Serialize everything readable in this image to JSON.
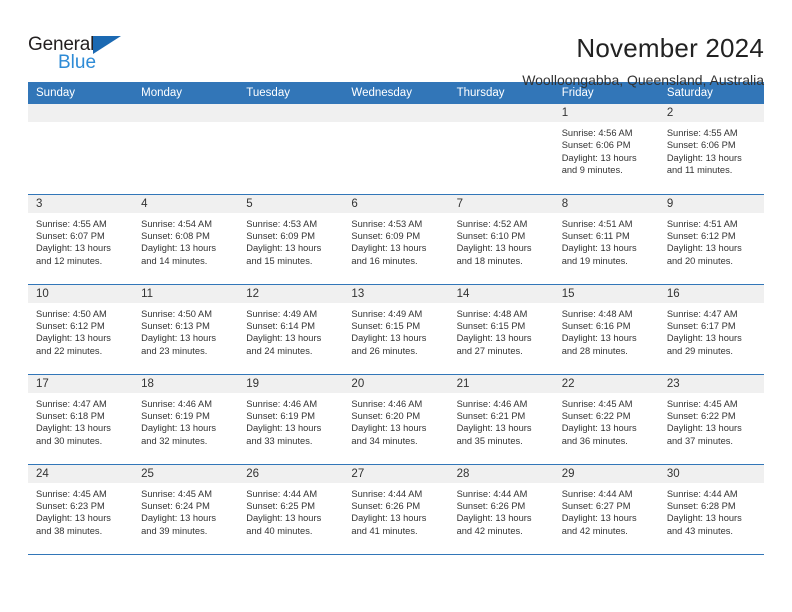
{
  "brand": {
    "name_part1": "General",
    "name_part2": "Blue",
    "triangle_icon": "triangle-icon",
    "accent_color": "#2e8bd6",
    "dark_color": "#231f20"
  },
  "header": {
    "title": "November 2024",
    "subtitle": "Woolloongabba, Queensland, Australia"
  },
  "calendar": {
    "header_bg": "#3276b8",
    "daynum_bg": "#f0f0f0",
    "weekdays": [
      "Sunday",
      "Monday",
      "Tuesday",
      "Wednesday",
      "Thursday",
      "Friday",
      "Saturday"
    ],
    "weeks": [
      [
        {
          "day": "",
          "lines": []
        },
        {
          "day": "",
          "lines": []
        },
        {
          "day": "",
          "lines": []
        },
        {
          "day": "",
          "lines": []
        },
        {
          "day": "",
          "lines": []
        },
        {
          "day": "1",
          "lines": [
            "Sunrise: 4:56 AM",
            "Sunset: 6:06 PM",
            "Daylight: 13 hours",
            "and 9 minutes."
          ]
        },
        {
          "day": "2",
          "lines": [
            "Sunrise: 4:55 AM",
            "Sunset: 6:06 PM",
            "Daylight: 13 hours",
            "and 11 minutes."
          ]
        }
      ],
      [
        {
          "day": "3",
          "lines": [
            "Sunrise: 4:55 AM",
            "Sunset: 6:07 PM",
            "Daylight: 13 hours",
            "and 12 minutes."
          ]
        },
        {
          "day": "4",
          "lines": [
            "Sunrise: 4:54 AM",
            "Sunset: 6:08 PM",
            "Daylight: 13 hours",
            "and 14 minutes."
          ]
        },
        {
          "day": "5",
          "lines": [
            "Sunrise: 4:53 AM",
            "Sunset: 6:09 PM",
            "Daylight: 13 hours",
            "and 15 minutes."
          ]
        },
        {
          "day": "6",
          "lines": [
            "Sunrise: 4:53 AM",
            "Sunset: 6:09 PM",
            "Daylight: 13 hours",
            "and 16 minutes."
          ]
        },
        {
          "day": "7",
          "lines": [
            "Sunrise: 4:52 AM",
            "Sunset: 6:10 PM",
            "Daylight: 13 hours",
            "and 18 minutes."
          ]
        },
        {
          "day": "8",
          "lines": [
            "Sunrise: 4:51 AM",
            "Sunset: 6:11 PM",
            "Daylight: 13 hours",
            "and 19 minutes."
          ]
        },
        {
          "day": "9",
          "lines": [
            "Sunrise: 4:51 AM",
            "Sunset: 6:12 PM",
            "Daylight: 13 hours",
            "and 20 minutes."
          ]
        }
      ],
      [
        {
          "day": "10",
          "lines": [
            "Sunrise: 4:50 AM",
            "Sunset: 6:12 PM",
            "Daylight: 13 hours",
            "and 22 minutes."
          ]
        },
        {
          "day": "11",
          "lines": [
            "Sunrise: 4:50 AM",
            "Sunset: 6:13 PM",
            "Daylight: 13 hours",
            "and 23 minutes."
          ]
        },
        {
          "day": "12",
          "lines": [
            "Sunrise: 4:49 AM",
            "Sunset: 6:14 PM",
            "Daylight: 13 hours",
            "and 24 minutes."
          ]
        },
        {
          "day": "13",
          "lines": [
            "Sunrise: 4:49 AM",
            "Sunset: 6:15 PM",
            "Daylight: 13 hours",
            "and 26 minutes."
          ]
        },
        {
          "day": "14",
          "lines": [
            "Sunrise: 4:48 AM",
            "Sunset: 6:15 PM",
            "Daylight: 13 hours",
            "and 27 minutes."
          ]
        },
        {
          "day": "15",
          "lines": [
            "Sunrise: 4:48 AM",
            "Sunset: 6:16 PM",
            "Daylight: 13 hours",
            "and 28 minutes."
          ]
        },
        {
          "day": "16",
          "lines": [
            "Sunrise: 4:47 AM",
            "Sunset: 6:17 PM",
            "Daylight: 13 hours",
            "and 29 minutes."
          ]
        }
      ],
      [
        {
          "day": "17",
          "lines": [
            "Sunrise: 4:47 AM",
            "Sunset: 6:18 PM",
            "Daylight: 13 hours",
            "and 30 minutes."
          ]
        },
        {
          "day": "18",
          "lines": [
            "Sunrise: 4:46 AM",
            "Sunset: 6:19 PM",
            "Daylight: 13 hours",
            "and 32 minutes."
          ]
        },
        {
          "day": "19",
          "lines": [
            "Sunrise: 4:46 AM",
            "Sunset: 6:19 PM",
            "Daylight: 13 hours",
            "and 33 minutes."
          ]
        },
        {
          "day": "20",
          "lines": [
            "Sunrise: 4:46 AM",
            "Sunset: 6:20 PM",
            "Daylight: 13 hours",
            "and 34 minutes."
          ]
        },
        {
          "day": "21",
          "lines": [
            "Sunrise: 4:46 AM",
            "Sunset: 6:21 PM",
            "Daylight: 13 hours",
            "and 35 minutes."
          ]
        },
        {
          "day": "22",
          "lines": [
            "Sunrise: 4:45 AM",
            "Sunset: 6:22 PM",
            "Daylight: 13 hours",
            "and 36 minutes."
          ]
        },
        {
          "day": "23",
          "lines": [
            "Sunrise: 4:45 AM",
            "Sunset: 6:22 PM",
            "Daylight: 13 hours",
            "and 37 minutes."
          ]
        }
      ],
      [
        {
          "day": "24",
          "lines": [
            "Sunrise: 4:45 AM",
            "Sunset: 6:23 PM",
            "Daylight: 13 hours",
            "and 38 minutes."
          ]
        },
        {
          "day": "25",
          "lines": [
            "Sunrise: 4:45 AM",
            "Sunset: 6:24 PM",
            "Daylight: 13 hours",
            "and 39 minutes."
          ]
        },
        {
          "day": "26",
          "lines": [
            "Sunrise: 4:44 AM",
            "Sunset: 6:25 PM",
            "Daylight: 13 hours",
            "and 40 minutes."
          ]
        },
        {
          "day": "27",
          "lines": [
            "Sunrise: 4:44 AM",
            "Sunset: 6:26 PM",
            "Daylight: 13 hours",
            "and 41 minutes."
          ]
        },
        {
          "day": "28",
          "lines": [
            "Sunrise: 4:44 AM",
            "Sunset: 6:26 PM",
            "Daylight: 13 hours",
            "and 42 minutes."
          ]
        },
        {
          "day": "29",
          "lines": [
            "Sunrise: 4:44 AM",
            "Sunset: 6:27 PM",
            "Daylight: 13 hours",
            "and 42 minutes."
          ]
        },
        {
          "day": "30",
          "lines": [
            "Sunrise: 4:44 AM",
            "Sunset: 6:28 PM",
            "Daylight: 13 hours",
            "and 43 minutes."
          ]
        }
      ]
    ]
  }
}
